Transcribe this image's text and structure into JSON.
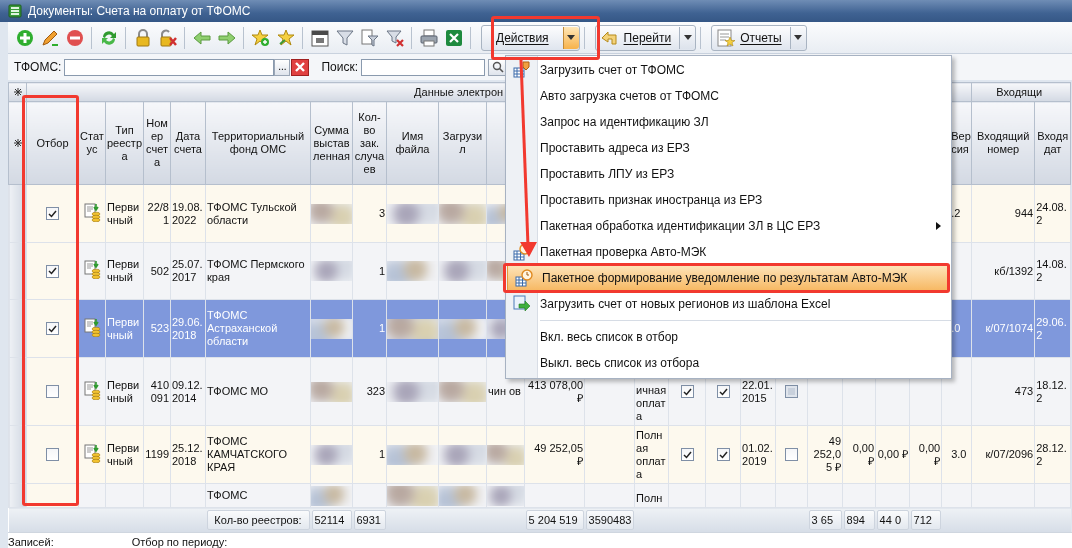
{
  "window": {
    "title": "Документы: Счета на оплату от ТФОМС"
  },
  "toolbar": {
    "actions_button": "Действия",
    "goto_button": "Перейти",
    "reports_button": "Отчеты"
  },
  "filter": {
    "fund_label": "ТФОМС:",
    "browse_button": "...",
    "search_label": "Поиск:"
  },
  "table": {
    "group_headers": {
      "main": "Данные электрон",
      "incoming": "Входящи"
    },
    "headers": {
      "selection": "Отбор",
      "status": "Статус",
      "type": "Тип реестра",
      "number": "Номер счета",
      "date": "Дата счета",
      "fund": "Территориальный фонд ОМС",
      "amount": "Сумма выставленная",
      "cases": "Кол-во зак. случаев",
      "file": "Имя файла",
      "loaded": "Загрузил",
      "version": "Вер сия",
      "incoming_number": "Входящий номер",
      "incoming_date": "Входя дат"
    },
    "rows": [
      {
        "selected": false,
        "checked": true,
        "status_icon": true,
        "type": "Первичный",
        "number": "22/81",
        "date": "19.08.2022",
        "fund": "ТФОМС Тульской области",
        "cases": "3",
        "version": ".2",
        "incoming_number": "944",
        "incoming_date": "24.08.2"
      },
      {
        "selected": false,
        "checked": true,
        "status_icon": true,
        "type": "Первичный",
        "number": "502",
        "date": "25.07.2017",
        "fund": "ТФОМС Пермского края",
        "cases": "1",
        "incoming_number": "кб/1392",
        "incoming_date": "14.08.2"
      },
      {
        "selected": true,
        "checked": true,
        "status_icon": true,
        "type": "Первичный",
        "number": "523",
        "date": "29.06.2018",
        "fund": "ТФОМС Астраханской области",
        "cases": "1",
        "version": ".0",
        "incoming_number": "к/07/1074",
        "incoming_date": "29.06.2"
      },
      {
        "selected": false,
        "checked": false,
        "status_icon": true,
        "type": "Первичный",
        "number": "410091",
        "date": "09.12.2014",
        "fund": "ТФОМС МО",
        "cases": "323",
        "pod": "чин ов",
        "column_12": "413 078,00 ₽",
        "column_14": "ичная оплата",
        "column_15": {
          "checked": true
        },
        "column_16": {
          "checked": true
        },
        "column_17": "22.01.2015",
        "column_18": {
          "checked": false,
          "indeterminate": true
        },
        "incoming_number": "473",
        "incoming_date": "18.12.2"
      },
      {
        "selected": false,
        "checked": false,
        "status_icon": true,
        "type": "Первичный",
        "number": "1199",
        "date": "25.12.2018",
        "fund": "ТФОМС КАМЧАТСКОГО КРАЯ",
        "cases": "1",
        "column_12": "49 252,05 ₽",
        "column_14": "Полная оплата",
        "column_15": {
          "checked": true
        },
        "column_16": {
          "checked": true
        },
        "column_17": "01.02.2019",
        "column_18": {
          "checked": false,
          "indeterminate": false
        },
        "column_19": "49 252,05 ₽",
        "column_20": "0,00 ₽",
        "column_21": "0,00 ₽",
        "column_22": "0,00 ₽",
        "version": "3.0",
        "incoming_number": "к/07/2096",
        "incoming_date": "28.12.2"
      },
      {
        "selected": false,
        "fund": "ТФОМС",
        "column_14": "Полн"
      }
    ],
    "totals": {
      "fund": "Кол-во реестров:",
      "amount": "52114",
      "cases": "6931",
      "column_12": "5 204 519",
      "column_13": "3590483",
      "column_19": "3 65",
      "column_20": "894",
      "column_21": "44 0",
      "column_22": "712"
    }
  },
  "status_bar": {
    "records_label": "Записей:",
    "period_label": "Отбор по периоду:"
  },
  "menu": {
    "items": [
      {
        "kind": "load",
        "label": "Загрузить счет от ТФОМС",
        "selected": false,
        "submenu": false
      },
      {
        "kind": "plain",
        "label": "Авто загрузка счетов от ТФОМС",
        "selected": false,
        "submenu": false
      },
      {
        "kind": "plain",
        "label": "Запрос на идентификацию ЗЛ",
        "selected": false,
        "submenu": false
      },
      {
        "kind": "plain",
        "label": "Проставить адреса из ЕРЗ",
        "selected": false,
        "submenu": false
      },
      {
        "kind": "plain",
        "label": "Проставить ЛПУ из ЕРЗ",
        "selected": false,
        "submenu": false
      },
      {
        "kind": "plain",
        "label": "Проставить признак иностранца из ЕРЗ",
        "selected": false,
        "submenu": false
      },
      {
        "kind": "plain",
        "label": "Пакетная обработка идентификации ЗЛ в ЦС ЕРЗ",
        "selected": false,
        "submenu": true
      },
      {
        "kind": "clock",
        "label": "Пакетная проверка Авто-МЭК",
        "selected": false,
        "submenu": false
      },
      {
        "kind": "clock",
        "label": "Пакетное формирование уведомление по результатам Авто-МЭК",
        "selected": true,
        "submenu": false
      },
      {
        "kind": "import",
        "label": "Загрузить счет от новых регионов из шаблона Excel",
        "selected": false,
        "submenu": false
      },
      {
        "kind": "separator"
      },
      {
        "kind": "plain",
        "label": "Вкл. весь список в отбор",
        "selected": false,
        "submenu": false
      },
      {
        "kind": "plain",
        "label": "Выкл. весь список из отбора",
        "selected": false,
        "submenu": false
      }
    ]
  }
}
